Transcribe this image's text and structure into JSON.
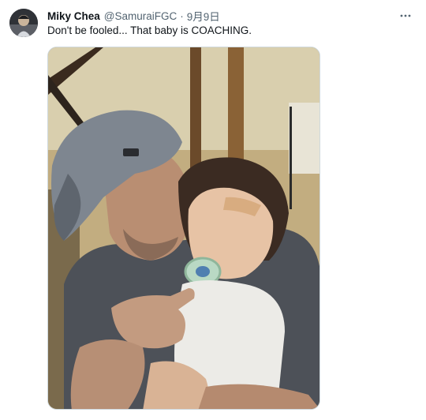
{
  "tweet": {
    "author_name": "Miky Chea",
    "handle": "@SamuraiFGC",
    "separator": "·",
    "date": "9月9日",
    "text": "Don't be fooled... That baby is COACHING.",
    "more_icon": "more-horizontal-icon",
    "media_alt": "Photo of a man in a grey cap pointing at the camera while holding a toddler with a pacifier"
  },
  "colors": {
    "text_primary": "#0f1419",
    "text_secondary": "#536471",
    "border": "#cfd9de",
    "background": "#ffffff"
  }
}
